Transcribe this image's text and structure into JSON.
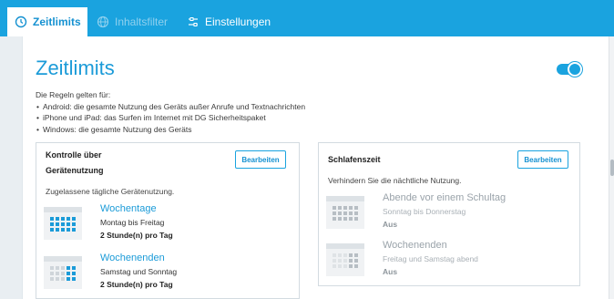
{
  "tabs": [
    {
      "label": "Zeitlimits",
      "active": true
    },
    {
      "label": "Inhaltsfilter",
      "active": false
    },
    {
      "label": "Einstellungen",
      "active": false
    }
  ],
  "page": {
    "title": "Zeitlimits",
    "toggle_on": true,
    "rules_intro": "Die Regeln gelten für:",
    "rules": [
      "Android: die gesamte Nutzung des Geräts außer Anrufe und Textnachrichten",
      "iPhone und iPad: das Surfen im Internet mit DG Sicherheitspaket",
      "Windows: die gesamte Nutzung des Geräts"
    ]
  },
  "card_usage": {
    "title_line1": "Kontrolle über",
    "title_line2": "Gerätenutzung",
    "edit_label": "Bearbeiten",
    "subtitle": "Zugelassene tägliche Gerätenutzung.",
    "rows": [
      {
        "title": "Wochentage",
        "days": "Montag bis Freitag",
        "value": "2 Stunde(n) pro Tag"
      },
      {
        "title": "Wochenenden",
        "days": "Samstag und Sonntag",
        "value": "2 Stunde(n) pro Tag"
      }
    ]
  },
  "card_bedtime": {
    "title": "Schlafenszeit",
    "edit_label": "Bearbeiten",
    "subtitle": "Verhindern Sie die nächtliche Nutzung.",
    "rows": [
      {
        "title": "Abende vor einem Schultag",
        "days": "Sonntag bis Donnerstag",
        "value": "Aus"
      },
      {
        "title": "Wochenenden",
        "days": "Freitag und Samstag abend",
        "value": "Aus"
      }
    ]
  },
  "colors": {
    "accent": "#1aa3df",
    "title": "#1b9bd8"
  }
}
